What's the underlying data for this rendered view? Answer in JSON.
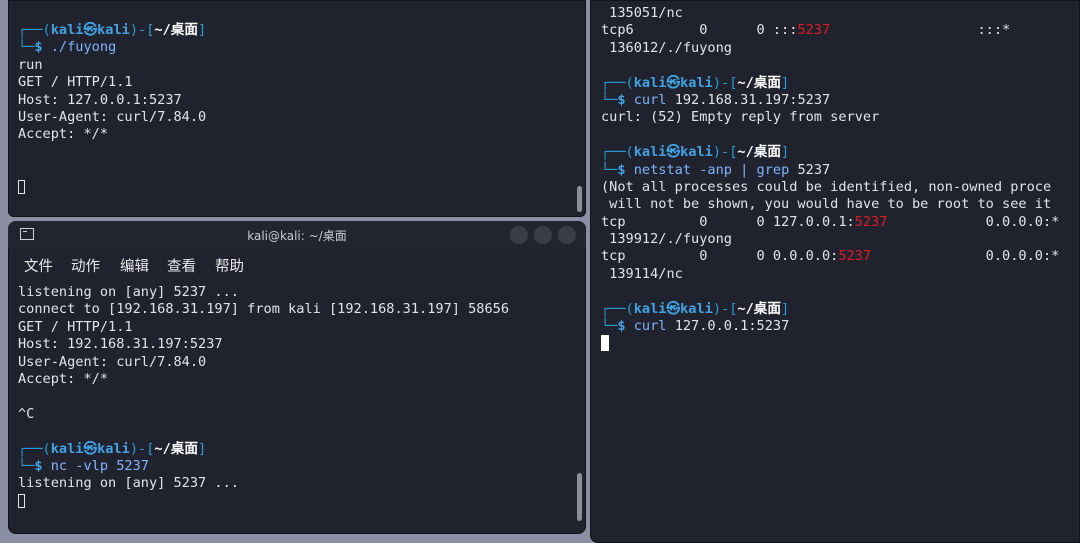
{
  "top_left": {
    "prompt": {
      "user": "kali",
      "host": "kali",
      "dir": "~/桌面"
    },
    "command": "./fuyong",
    "output": [
      "run",
      "GET / HTTP/1.1",
      "Host: 127.0.0.1:5237",
      "User-Agent: curl/7.84.0",
      "Accept: */*"
    ]
  },
  "bottom_left": {
    "title": "kali@kali: ~/桌面",
    "menu": [
      "文件",
      "动作",
      "编辑",
      "查看",
      "帮助"
    ],
    "output": [
      "listening on [any] 5237 ...",
      "connect to [192.168.31.197] from kali [192.168.31.197] 58656",
      "GET / HTTP/1.1",
      "Host: 192.168.31.197:5237",
      "User-Agent: curl/7.84.0",
      "Accept: */*"
    ],
    "ctrl_c": "^C",
    "prompt": {
      "user": "kali",
      "host": "kali",
      "dir": "~/桌面"
    },
    "command": {
      "name": "nc",
      "args": "-vlp 5237"
    },
    "after": "listening on [any] 5237 ..."
  },
  "right": {
    "lines_top": {
      "l1": " 135051/nc",
      "tcp6_a": "tcp6        0      0 :::",
      "tcp6_port": "5237",
      "tcp6_b": "                  :::*",
      "l3": " 136012/./fuyong"
    },
    "prompt1": {
      "user": "kali",
      "host": "kali",
      "dir": "~/桌面"
    },
    "cmd1": {
      "name": "curl",
      "args": "192.168.31.197:5237"
    },
    "out1": "curl: (52) Empty reply from server",
    "prompt2": {
      "user": "kali",
      "host": "kali",
      "dir": "~/桌面"
    },
    "cmd2": {
      "name": "netstat",
      "args": "-anp",
      "pipe": "|",
      "name2": "grep",
      "args2": "5237"
    },
    "netstat": {
      "warn1": "(Not all processes could be identified, non-owned proce",
      "warn2": " will not be shown, you would have to be root to see it",
      "r1a": "tcp         0      0 127.0.0.1:",
      "r1port": "5237",
      "r1b": "            0.0.0.0:*",
      "r1c": " 139912/./fuyong",
      "r2a": "tcp         0      0 0.0.0.0:",
      "r2port": "5237",
      "r2b": "              0.0.0.0:*",
      "r2c": " 139114/nc"
    },
    "prompt3": {
      "user": "kali",
      "host": "kali",
      "dir": "~/桌面"
    },
    "cmd3": {
      "name": "curl",
      "args": "127.0.0.1:5237"
    }
  },
  "glyphs": {
    "corner_top": "┌──(",
    "corner_bot": "└─",
    "at": "㉿",
    "close": ")-[",
    "end": "]",
    "dollar": "$"
  }
}
